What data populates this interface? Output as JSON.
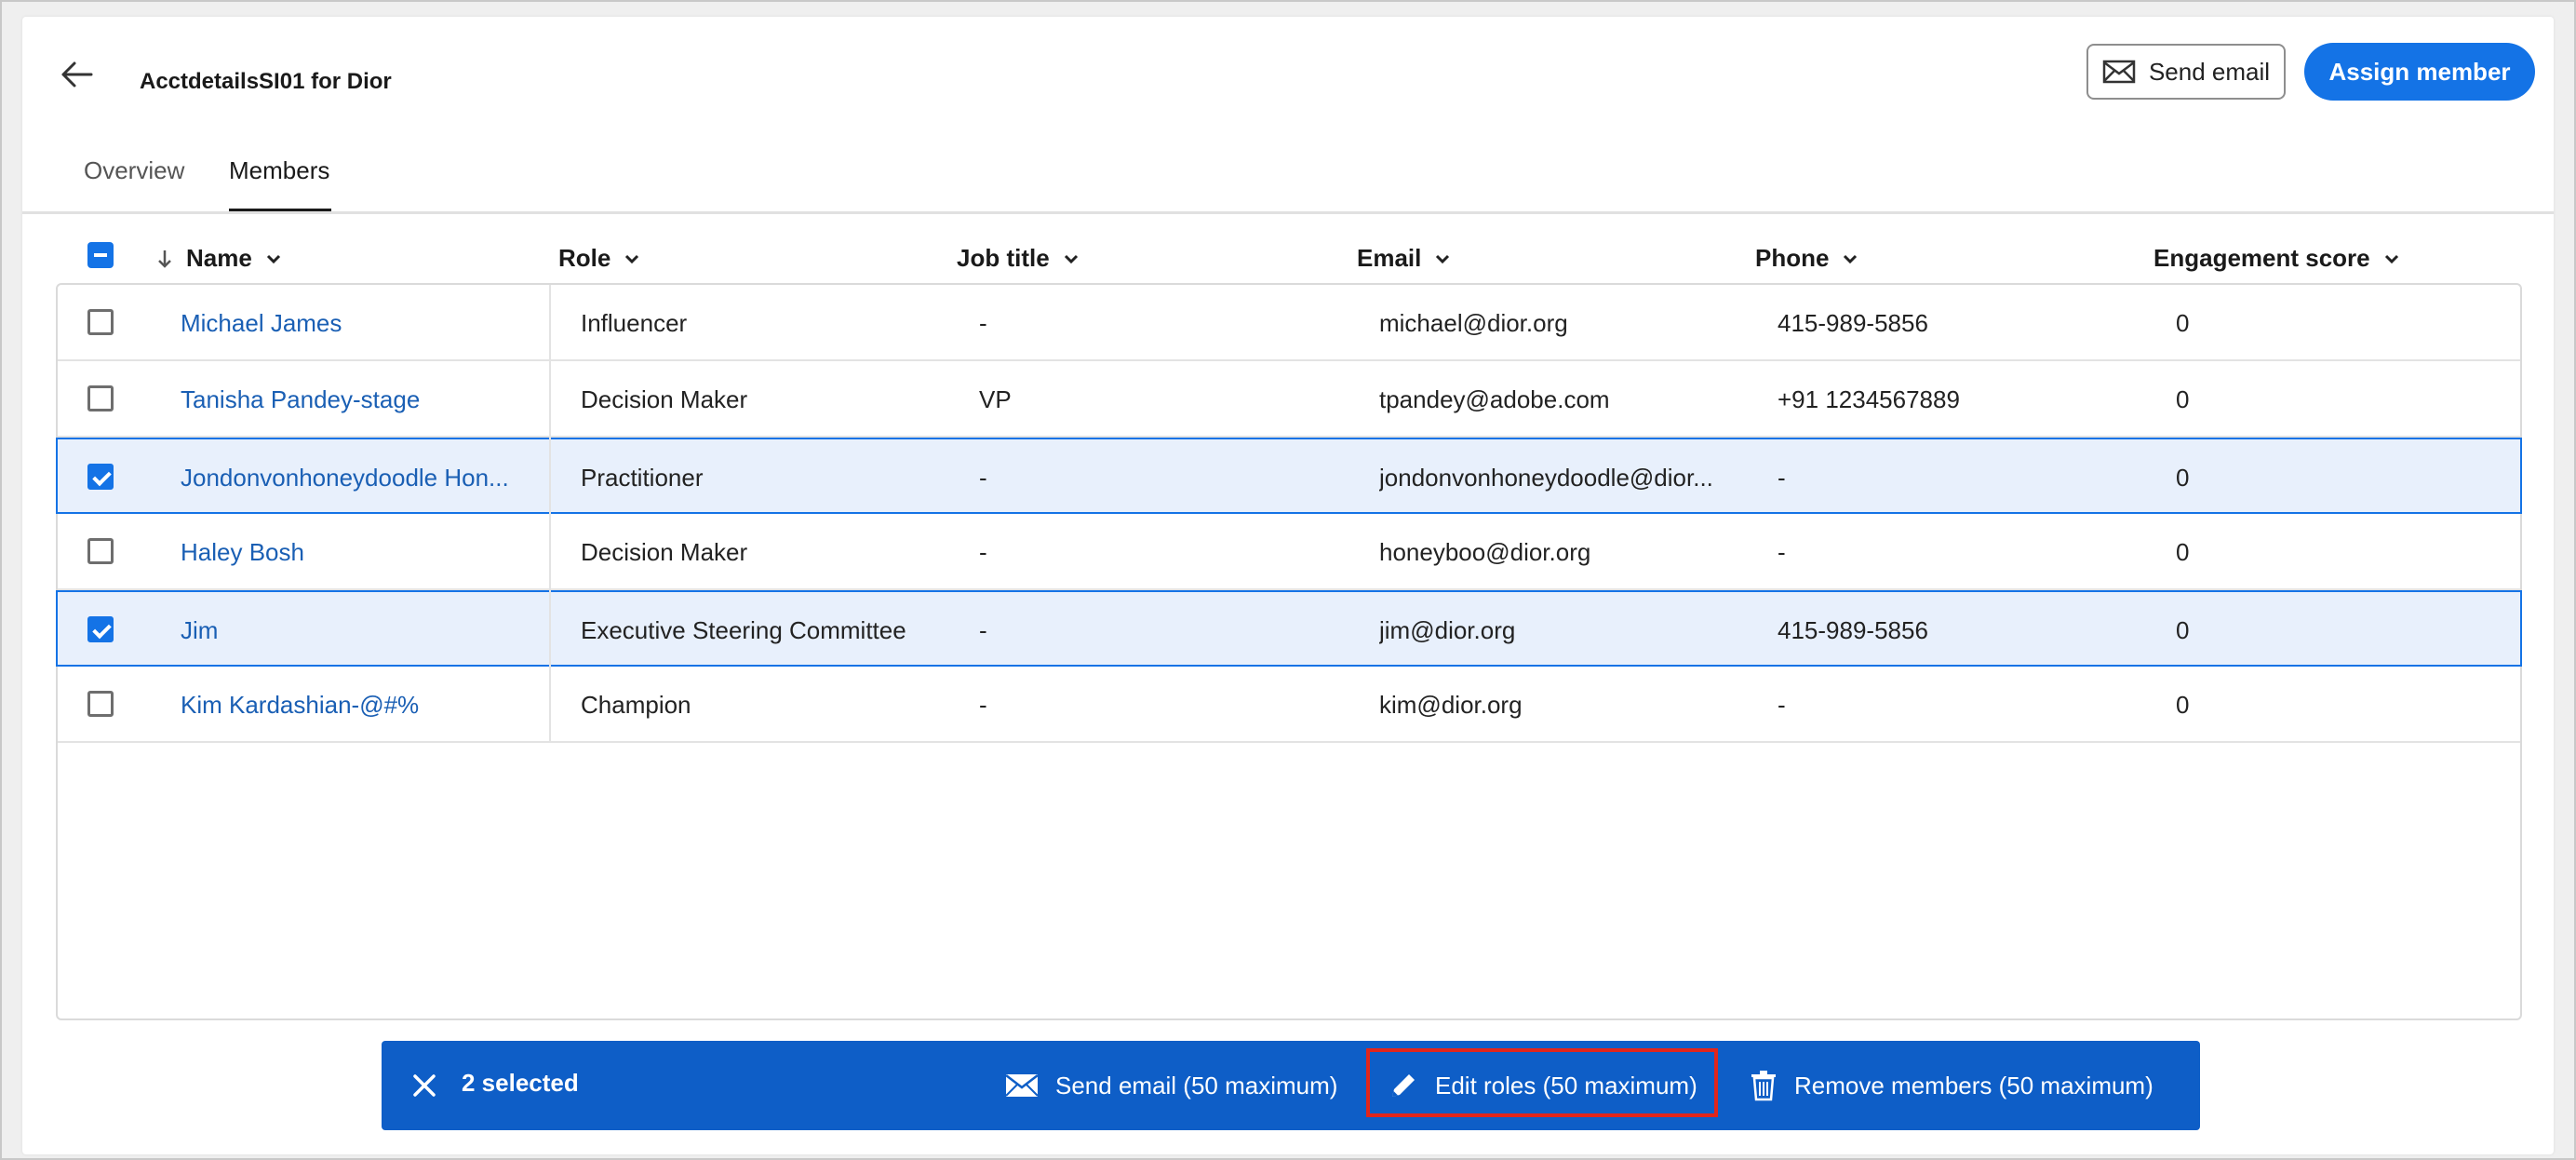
{
  "header": {
    "title": "AcctdetailsSI01 for Dior",
    "send_email_label": "Send email",
    "assign_member_label": "Assign member"
  },
  "tabs": [
    {
      "label": "Overview",
      "active": false
    },
    {
      "label": "Members",
      "active": true
    }
  ],
  "table": {
    "columns": [
      "Name",
      "Role",
      "Job title",
      "Email",
      "Phone",
      "Engagement score"
    ],
    "sort_column": "Name",
    "rows": [
      {
        "selected": false,
        "name": "Michael James",
        "role": "Influencer",
        "job": "-",
        "email": "michael@dior.org",
        "phone": "415-989-5856",
        "score": "0"
      },
      {
        "selected": false,
        "name": "Tanisha Pandey-stage",
        "role": "Decision Maker",
        "job": "VP",
        "email": "tpandey@adobe.com",
        "phone": "+91 1234567889",
        "score": "0"
      },
      {
        "selected": true,
        "name": "Jondonvonhoneydoodle Hon...",
        "role": "Practitioner",
        "job": "-",
        "email": "jondonvonhoneydoodle@dior...",
        "phone": "-",
        "score": "0"
      },
      {
        "selected": false,
        "name": "Haley Bosh",
        "role": "Decision Maker",
        "job": "-",
        "email": "honeyboo@dior.org",
        "phone": "-",
        "score": "0"
      },
      {
        "selected": true,
        "name": "Jim",
        "role": "Executive Steering Committee",
        "job": "-",
        "email": "jim@dior.org",
        "phone": "415-989-5856",
        "score": "0"
      },
      {
        "selected": false,
        "name": "Kim Kardashian-@#%",
        "role": "Champion",
        "job": "-",
        "email": "kim@dior.org",
        "phone": "-",
        "score": "0"
      }
    ]
  },
  "action_bar": {
    "selected_count": "2 selected",
    "send_email": "Send email (50 maximum)",
    "edit_roles": "Edit roles (50 maximum)",
    "remove_members": "Remove members (50 maximum)"
  },
  "colors": {
    "accent": "#1473e6",
    "action_bar": "#0e5ec7",
    "link": "#1a5fb4",
    "highlight": "#e1251b"
  },
  "icons": [
    "back-arrow-icon",
    "envelope-icon",
    "sort-down-icon",
    "chevron-down-icon",
    "close-icon",
    "pencil-icon",
    "trash-icon"
  ]
}
